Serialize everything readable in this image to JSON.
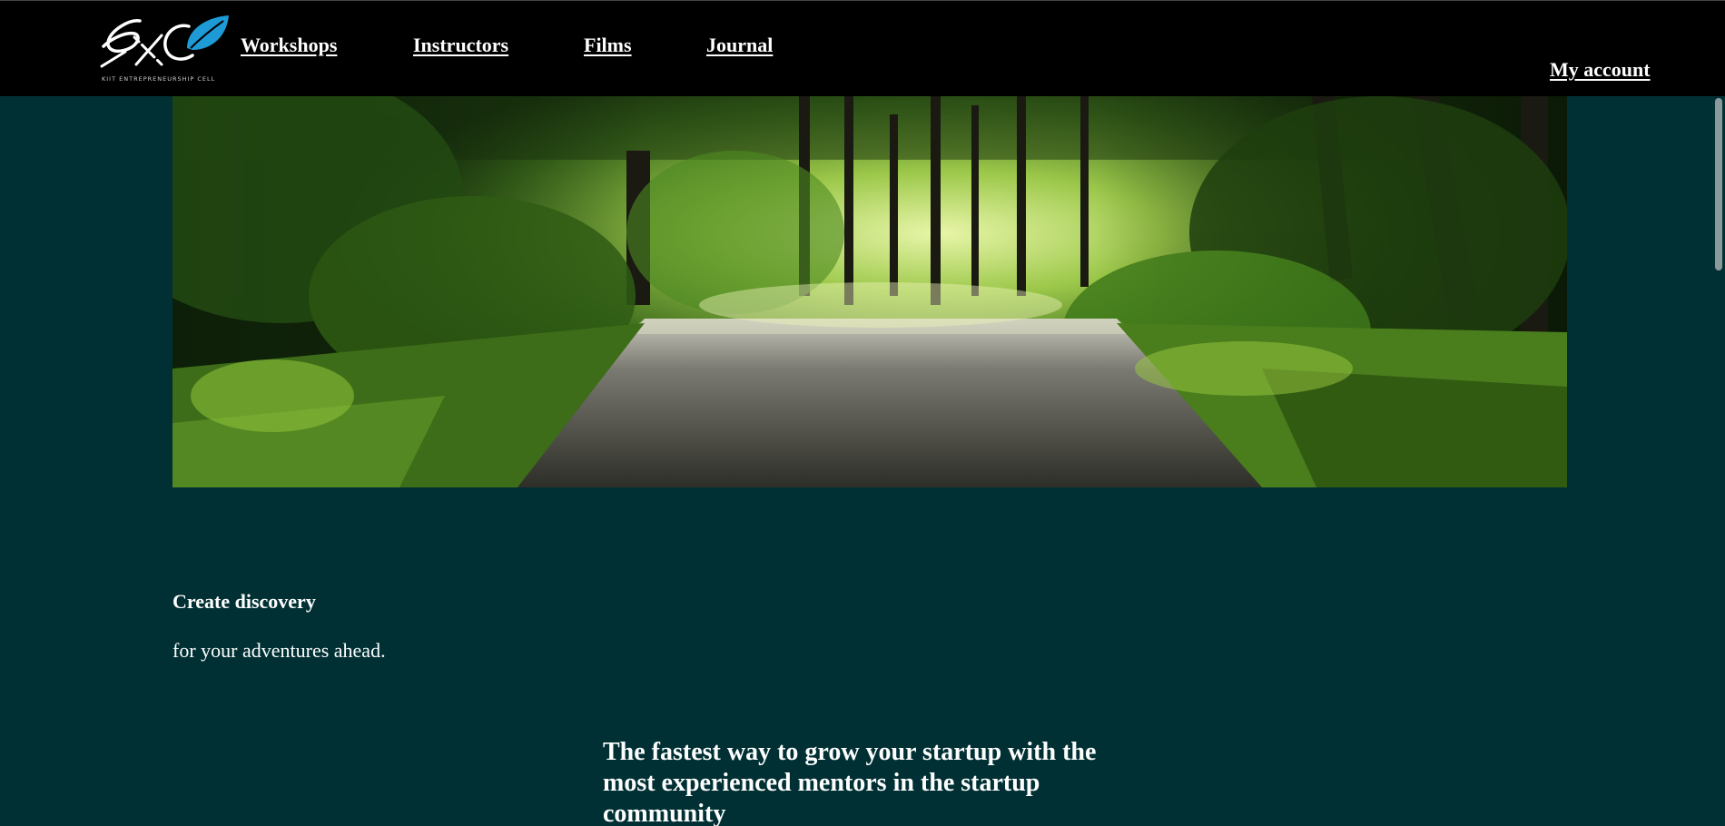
{
  "header": {
    "logo_caption": "KIIT ENTREPRENEURSHIP CELL",
    "nav": {
      "workshops": "Workshops",
      "instructors": "Instructors",
      "films": "Films",
      "journal": "Journal"
    },
    "account": "My account"
  },
  "hero": {
    "image": "forest-road-photo"
  },
  "content": {
    "discovery_title": "Create discovery",
    "discovery_subtitle": "for your adventures ahead.",
    "tagline": "The fastest way to grow your startup with the most experienced mentors in the startup community"
  },
  "colors": {
    "page_background": "#003034",
    "header_background": "#000000",
    "text": "#ffffff",
    "logo_accent": "#1e9ad6"
  }
}
